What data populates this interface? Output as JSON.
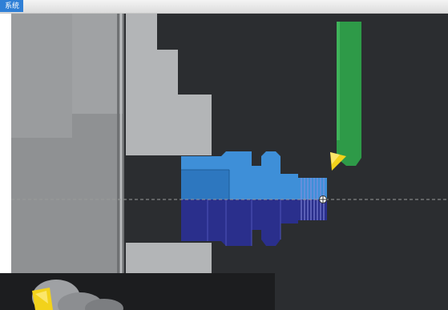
{
  "window": {
    "title_badge": "系统"
  },
  "scene": {
    "colors": {
      "background": "#2b2d30",
      "chuck_gray": "#8f9193",
      "jaw_gray": "#b3b5b7",
      "workpiece_blue": "#3e8fd8",
      "workpiece_navy": "#2a2f8c",
      "tool_green": "#2e9a48",
      "insert_yellow": "#f2d21b",
      "centerline": "#9a9a9a"
    },
    "icons": [
      "chuck-body",
      "upper-jaw",
      "lower-jaw",
      "workpiece",
      "turning-tool",
      "tool-insert",
      "origin-marker-icon"
    ]
  },
  "inset": {
    "description_icons": [
      "3d-part-preview"
    ]
  }
}
